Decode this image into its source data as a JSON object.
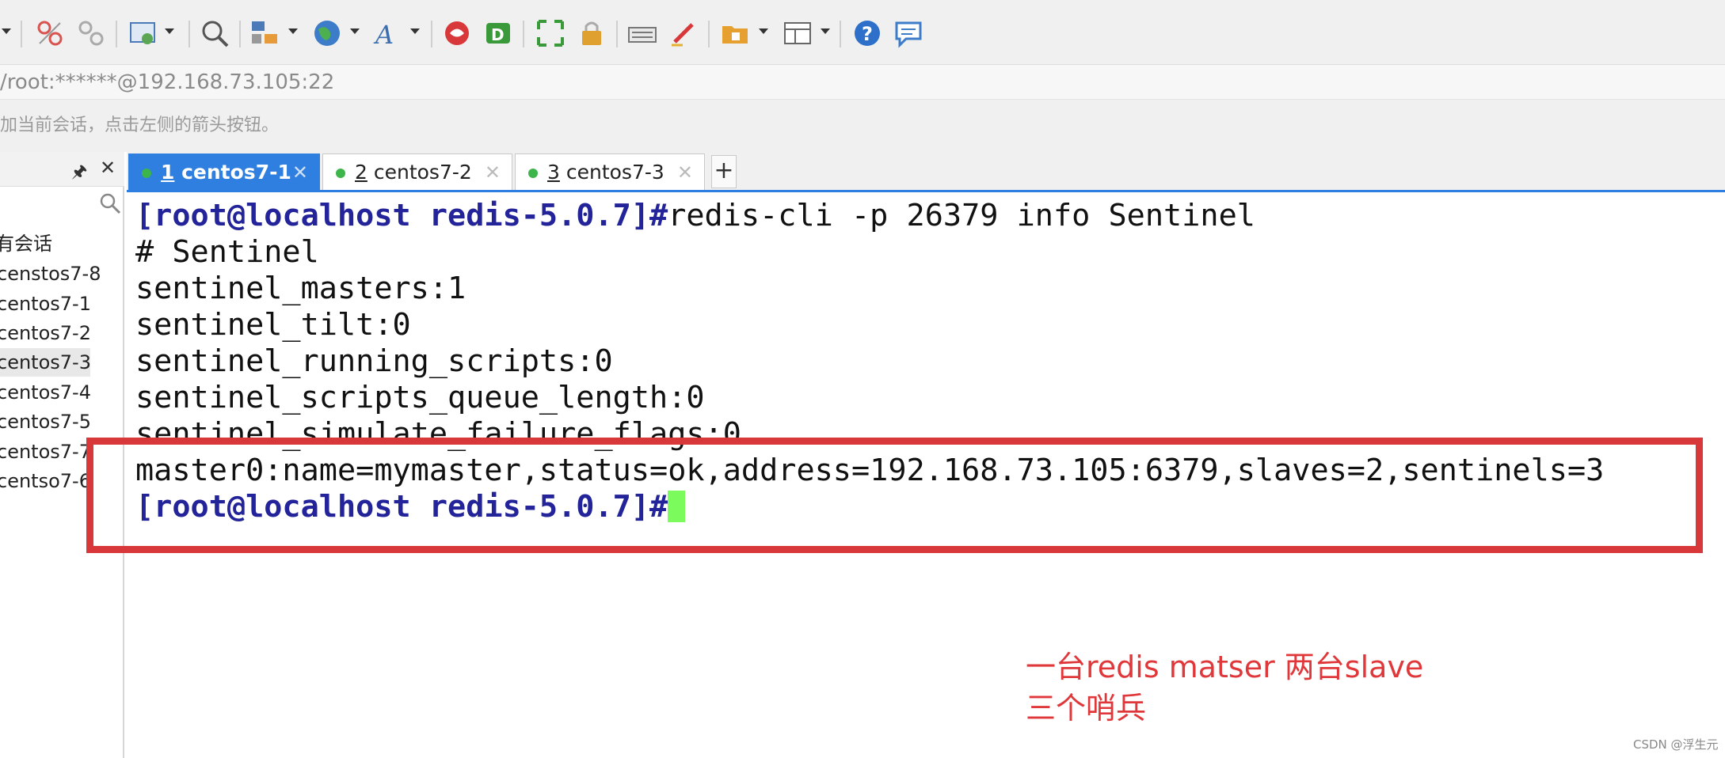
{
  "toolbar": {
    "icons": [
      "dropdown-arrow",
      "disconnect",
      "reconnect",
      "properties",
      "find",
      "transfer",
      "globe",
      "font",
      "xftp",
      "xshell-green",
      "fullscreen",
      "lock",
      "keyboard",
      "highlight",
      "new-folder",
      "layout",
      "help",
      "chat"
    ]
  },
  "address": {
    "text": "/root:******@192.168.73.105:22"
  },
  "hint": {
    "text": "加当前会话，点击左侧的箭头按钮。"
  },
  "sidebar": {
    "pin_glyph": "🖈",
    "close_glyph": "✕",
    "items": [
      {
        "label": "有会话"
      },
      {
        "label": "censtos7-8"
      },
      {
        "label": "centos7-1"
      },
      {
        "label": "centos7-2"
      },
      {
        "label": "centos7-3"
      },
      {
        "label": "centos7-4"
      },
      {
        "label": "centos7-5"
      },
      {
        "label": "centos7-7"
      },
      {
        "label": "centso7-6"
      }
    ]
  },
  "tabs": [
    {
      "num": "1",
      "name": " centos7-1",
      "close": "✕"
    },
    {
      "num": "2",
      "name": " centos7-2",
      "close": "✕"
    },
    {
      "num": "3",
      "name": " centos7-3",
      "close": "✕"
    }
  ],
  "tab_add": "+",
  "terminal": {
    "line1_prompt": "[root@localhost redis-5.0.7]#",
    "line1_cmd": "redis-cli -p 26379 info Sentinel",
    "line2": "# Sentinel",
    "line3": "sentinel_masters:1",
    "line4": "sentinel_tilt:0",
    "line5": "sentinel_running_scripts:0",
    "line6": "sentinel_scripts_queue_length:0",
    "line7": "sentinel_simulate_failure_flags:0",
    "line8": "master0:name=mymaster,status=ok,address=192.168.73.105:6379,slaves=2,sentinels=3",
    "line9_prompt": "[root@localhost redis-5.0.7]#"
  },
  "annotation": {
    "line1": "一台redis matser  两台slave",
    "line2": "三个哨兵"
  },
  "watermark": "CSDN @浮生元",
  "colors": {
    "tab_active": "#2e7fe0",
    "prompt": "#23239a",
    "cursor": "#7cfc5c",
    "highlight": "#d9383a"
  }
}
